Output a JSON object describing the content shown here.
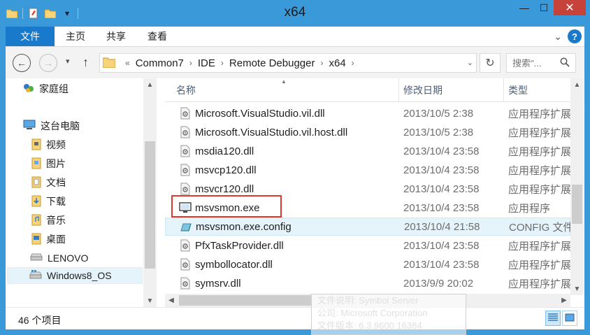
{
  "window": {
    "title": "x64",
    "minimize_glyph": "—",
    "maximize_glyph": "☐",
    "close_glyph": "✕"
  },
  "qat": {
    "dropdown_glyph": "▾"
  },
  "ribbon": {
    "tabs": [
      {
        "label": "文件"
      },
      {
        "label": "主页"
      },
      {
        "label": "共享"
      },
      {
        "label": "查看"
      }
    ],
    "help_glyph": "?",
    "expand_glyph": "⌄"
  },
  "nav": {
    "back_glyph": "←",
    "forward_glyph": "→",
    "recent_glyph": "▾",
    "up_glyph": "↑",
    "refresh_glyph": "↻"
  },
  "address": {
    "overflow": "«",
    "separator": "›",
    "breadcrumbs": [
      "Common7",
      "IDE",
      "Remote Debugger",
      "x64"
    ],
    "dropdown_glyph": "⌄"
  },
  "search": {
    "placeholder": "搜索\"..."
  },
  "sidebar": {
    "homegroup": "家庭组",
    "computer": "这台电脑",
    "items": [
      {
        "label": "视频"
      },
      {
        "label": "图片"
      },
      {
        "label": "文档"
      },
      {
        "label": "下载"
      },
      {
        "label": "音乐"
      },
      {
        "label": "桌面"
      },
      {
        "label": "LENOVO"
      },
      {
        "label": "Windows8_OS"
      }
    ]
  },
  "columns": {
    "name": "名称",
    "date": "修改日期",
    "type": "类型"
  },
  "files": [
    {
      "name": "Microsoft.VisualStudio.vil.dll",
      "date": "2013/10/5 2:38",
      "type": "应用程序扩展",
      "icon": "dll-icon"
    },
    {
      "name": "Microsoft.VisualStudio.vil.host.dll",
      "date": "2013/10/5 2:38",
      "type": "应用程序扩展",
      "icon": "dll-icon"
    },
    {
      "name": "msdia120.dll",
      "date": "2013/10/4 23:58",
      "type": "应用程序扩展",
      "icon": "dll-icon"
    },
    {
      "name": "msvcp120.dll",
      "date": "2013/10/4 23:58",
      "type": "应用程序扩展",
      "icon": "dll-icon"
    },
    {
      "name": "msvcr120.dll",
      "date": "2013/10/4 23:58",
      "type": "应用程序扩展",
      "icon": "dll-icon"
    },
    {
      "name": "msvsmon.exe",
      "date": "2013/10/4 23:58",
      "type": "应用程序",
      "icon": "exe-icon"
    },
    {
      "name": "msvsmon.exe.config",
      "date": "2013/10/4 21:58",
      "type": "CONFIG 文件",
      "icon": "config-icon"
    },
    {
      "name": "PfxTaskProvider.dll",
      "date": "2013/10/4 23:58",
      "type": "应用程序扩展",
      "icon": "dll-icon"
    },
    {
      "name": "symbollocator.dll",
      "date": "2013/10/4 23:58",
      "type": "应用程序扩展",
      "icon": "dll-icon"
    },
    {
      "name": "symsrv.dll",
      "date": "2013/9/9 20:02",
      "type": "应用程序扩展",
      "icon": "dll-icon"
    }
  ],
  "scroll": {
    "up_glyph": "▲",
    "down_glyph": "▼",
    "left_glyph": "◀",
    "right_glyph": "▶"
  },
  "status": {
    "item_count": "46 个项目"
  },
  "watermark": {
    "line1": "文件说明: Symbol Server",
    "line2": "公司: Microsoft Corporation",
    "line3": "文件版本: 6.3.9600.16384"
  },
  "colors": {
    "titlebar": "#3a9ad9",
    "file_tab": "#1979ca",
    "close": "#c7423a",
    "selection": "#e5f3fb",
    "highlight_box": "#e0382b"
  }
}
